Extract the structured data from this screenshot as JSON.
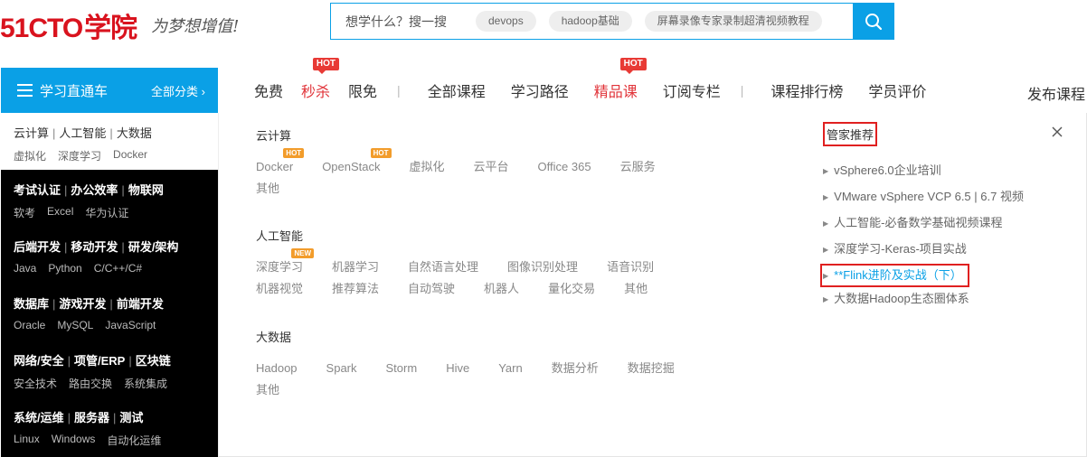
{
  "header": {
    "logo": "51CTO学院",
    "logo_num": "51CTO",
    "logo_cn": "学院",
    "slogan": "为梦想增值!",
    "search": {
      "placeholder": "想学什么？搜一搜",
      "tags": [
        "devops",
        "hadoop基础",
        "屏幕录像专家录制超清视频教程"
      ]
    }
  },
  "nav": {
    "left_title": "学习直通车",
    "left_all": "全部分类 ›",
    "items": [
      {
        "label": "免费",
        "hot": ""
      },
      {
        "label": "秒杀",
        "hot": "HOT"
      },
      {
        "label": "限免",
        "hot": ""
      },
      {
        "label": "全部课程",
        "hot": ""
      },
      {
        "label": "学习路径",
        "hot": ""
      },
      {
        "label": "精品课",
        "hot": "HOT"
      },
      {
        "label": "订阅专栏",
        "hot": ""
      },
      {
        "label": "课程排行榜",
        "hot": ""
      },
      {
        "label": "学员评价",
        "hot": ""
      }
    ],
    "publish": "发布课程"
  },
  "sidebar": [
    {
      "heads": [
        "云计算",
        "人工智能",
        "大数据"
      ],
      "subs": [
        "虚拟化",
        "深度学习",
        "Docker"
      ]
    },
    {
      "heads": [
        "考试认证",
        "办公效率",
        "物联网"
      ],
      "subs": [
        "软考",
        "Excel",
        "华为认证"
      ]
    },
    {
      "heads": [
        "后端开发",
        "移动开发",
        "研发/架构"
      ],
      "subs": [
        "Java",
        "Python",
        "C/C++/C#"
      ]
    },
    {
      "heads": [
        "数据库",
        "游戏开发",
        "前端开发"
      ],
      "subs": [
        "Oracle",
        "MySQL",
        "JavaScript"
      ]
    },
    {
      "heads": [
        "网络/安全",
        "项管/ERP",
        "区块链"
      ],
      "subs": [
        "安全技术",
        "路由交换",
        "系统集成"
      ]
    },
    {
      "heads": [
        "系统/运维",
        "服务器",
        "测试"
      ],
      "subs": [
        "Linux",
        "Windows",
        "自动化运维"
      ]
    }
  ],
  "panel": {
    "groups": [
      {
        "title": "云计算",
        "rows": [
          [
            {
              "t": "Docker",
              "b": "HOT"
            },
            {
              "t": "OpenStack",
              "b": "HOT"
            },
            {
              "t": "虚拟化"
            },
            {
              "t": "云平台"
            },
            {
              "t": "Office 365"
            },
            {
              "t": "云服务"
            }
          ],
          [
            {
              "t": "其他"
            }
          ]
        ]
      },
      {
        "title": "人工智能",
        "rows": [
          [
            {
              "t": "深度学习",
              "b": "NEW"
            },
            {
              "t": "机器学习"
            },
            {
              "t": "自然语言处理"
            },
            {
              "t": "图像识别处理"
            },
            {
              "t": "语音识别"
            }
          ],
          [
            {
              "t": "机器视觉"
            },
            {
              "t": "推荐算法"
            },
            {
              "t": "自动驾驶"
            },
            {
              "t": "机器人"
            },
            {
              "t": "量化交易"
            },
            {
              "t": "其他"
            }
          ]
        ]
      },
      {
        "title": "大数据",
        "rows": [
          [
            {
              "t": "Hadoop"
            },
            {
              "t": "Spark"
            },
            {
              "t": "Storm"
            },
            {
              "t": "Hive"
            },
            {
              "t": "Yarn"
            },
            {
              "t": "数据分析"
            },
            {
              "t": "数据挖掘"
            }
          ],
          [
            {
              "t": "其他"
            }
          ]
        ]
      }
    ],
    "recommend": {
      "title": "管家推荐",
      "items": [
        "vSphere6.0企业培训",
        "VMware vSphere VCP 6.5 | 6.7 视频",
        "人工智能-必备数学基础视频课程",
        "深度学习-Keras-项目实战",
        "**Flink进阶及实战（下）",
        "大数据Hadoop生态圈体系"
      ],
      "highlight_index": 4
    }
  },
  "colors": {
    "brand_red": "#d9131e",
    "accent_blue": "#0aa0e6",
    "hot_red": "#e83a35",
    "badge_orange": "#f29c2b"
  }
}
